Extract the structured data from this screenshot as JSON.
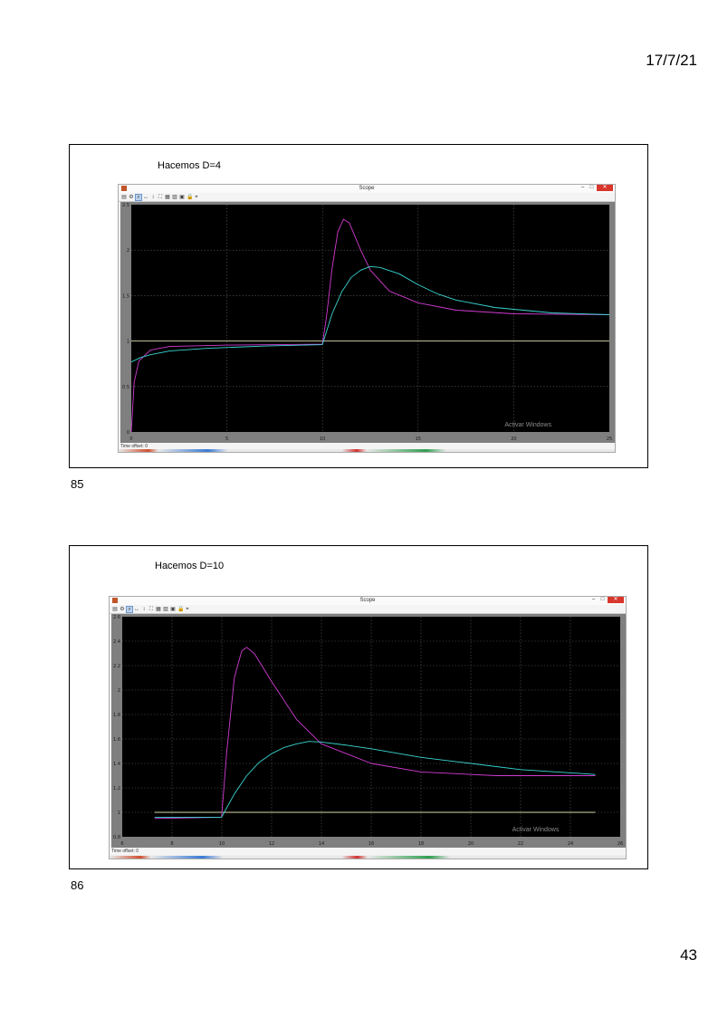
{
  "header": {
    "date": "17/7/21"
  },
  "footer": {
    "page_number": "43"
  },
  "colors": {
    "magenta": "#d23cd2",
    "cyan": "#3ad6d2",
    "reference": "#d8d8a8",
    "grid": "#5a5a5a",
    "plot_bg": "#000000"
  },
  "slides": [
    {
      "number": "85",
      "title": "Hacemos D=4",
      "scope": {
        "window_title": "Scope",
        "status_text": "Time offset: 0",
        "watermark": "Activar Windows",
        "icons": [
          "print-icon",
          "settings-icon",
          "zoom-icon",
          "zoom-x-icon",
          "zoom-y-icon",
          "autoscale-icon",
          "save-axes-icon",
          "restore-axes-icon",
          "parameters-icon",
          "lock-icon",
          "select-signals-icon"
        ]
      },
      "chart_data": {
        "type": "line",
        "xlim": [
          0,
          25
        ],
        "ylim": [
          0,
          2.5
        ],
        "x_ticks": [
          "0",
          "5",
          "10",
          "15",
          "20",
          "25"
        ],
        "y_ticks": [
          "0",
          "0.5",
          "1",
          "1.5",
          "2",
          "2.5"
        ],
        "grid": true,
        "series": [
          {
            "color": "#d8d8a8",
            "points": [
              [
                0,
                1.0
              ],
              [
                25,
                1.0
              ]
            ]
          },
          {
            "color": "#d23cd2",
            "points": [
              [
                0,
                0.0
              ],
              [
                0.15,
                0.55
              ],
              [
                0.4,
                0.78
              ],
              [
                1,
                0.9
              ],
              [
                2,
                0.94
              ],
              [
                5,
                0.955
              ],
              [
                9.99,
                0.965
              ],
              [
                10.2,
                1.25
              ],
              [
                10.5,
                1.8
              ],
              [
                10.8,
                2.2
              ],
              [
                11.1,
                2.34
              ],
              [
                11.4,
                2.3
              ],
              [
                12,
                2.0
              ],
              [
                12.5,
                1.78
              ],
              [
                13.5,
                1.55
              ],
              [
                15,
                1.42
              ],
              [
                17,
                1.34
              ],
              [
                20,
                1.3
              ],
              [
                25,
                1.29
              ]
            ]
          },
          {
            "color": "#3ad6d2",
            "points": [
              [
                0,
                0.77
              ],
              [
                0.5,
                0.82
              ],
              [
                1,
                0.85
              ],
              [
                2,
                0.89
              ],
              [
                4,
                0.92
              ],
              [
                7,
                0.945
              ],
              [
                9.99,
                0.96
              ],
              [
                10.5,
                1.3
              ],
              [
                11,
                1.54
              ],
              [
                11.5,
                1.7
              ],
              [
                12,
                1.78
              ],
              [
                12.5,
                1.82
              ],
              [
                13,
                1.81
              ],
              [
                14,
                1.74
              ],
              [
                15,
                1.62
              ],
              [
                16,
                1.52
              ],
              [
                17,
                1.45
              ],
              [
                19,
                1.37
              ],
              [
                22,
                1.31
              ],
              [
                25,
                1.29
              ]
            ]
          }
        ]
      }
    },
    {
      "number": "86",
      "title": "Hacemos D=10",
      "scope": {
        "window_title": "Scope",
        "status_text": "Time offset: 0",
        "watermark": "Activar Windows",
        "icons": [
          "print-icon",
          "settings-icon",
          "zoom-icon",
          "zoom-x-icon",
          "zoom-y-icon",
          "autoscale-icon",
          "save-axes-icon",
          "restore-axes-icon",
          "parameters-icon",
          "lock-icon",
          "select-signals-icon"
        ]
      },
      "chart_data": {
        "type": "line",
        "xlim": [
          6,
          26
        ],
        "ylim": [
          0.8,
          2.6
        ],
        "x_ticks": [
          "6",
          "8",
          "10",
          "12",
          "14",
          "16",
          "18",
          "20",
          "22",
          "24",
          "26"
        ],
        "y_ticks": [
          "0.8",
          "1",
          "1.2",
          "1.4",
          "1.6",
          "1.8",
          "2",
          "2.2",
          "2.4",
          "2.6"
        ],
        "grid": true,
        "series": [
          {
            "color": "#d8d8a8",
            "points": [
              [
                7.3,
                1.0
              ],
              [
                25,
                1.0
              ]
            ]
          },
          {
            "color": "#d23cd2",
            "points": [
              [
                7.3,
                0.95
              ],
              [
                9.99,
                0.96
              ],
              [
                10.2,
                1.5
              ],
              [
                10.5,
                2.1
              ],
              [
                10.8,
                2.32
              ],
              [
                11,
                2.35
              ],
              [
                11.3,
                2.3
              ],
              [
                12,
                2.07
              ],
              [
                13,
                1.76
              ],
              [
                14,
                1.56
              ],
              [
                16,
                1.4
              ],
              [
                18,
                1.33
              ],
              [
                21,
                1.3
              ],
              [
                25,
                1.3
              ]
            ]
          },
          {
            "color": "#3ad6d2",
            "points": [
              [
                7.3,
                0.96
              ],
              [
                9.99,
                0.96
              ],
              [
                10.5,
                1.15
              ],
              [
                11,
                1.3
              ],
              [
                11.5,
                1.41
              ],
              [
                12,
                1.48
              ],
              [
                12.5,
                1.53
              ],
              [
                13,
                1.56
              ],
              [
                13.5,
                1.58
              ],
              [
                14,
                1.575
              ],
              [
                15,
                1.55
              ],
              [
                16,
                1.52
              ],
              [
                18,
                1.45
              ],
              [
                20,
                1.4
              ],
              [
                22,
                1.35
              ],
              [
                25,
                1.31
              ]
            ]
          }
        ]
      }
    }
  ]
}
